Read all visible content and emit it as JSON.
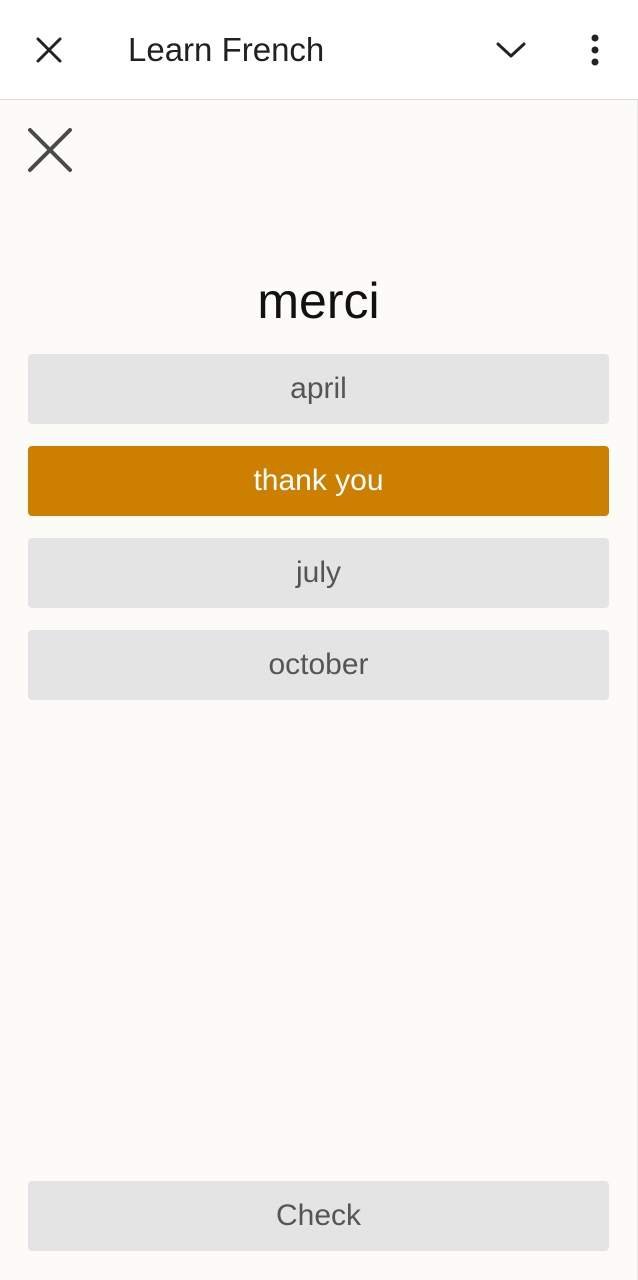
{
  "appbar": {
    "title": "Learn French",
    "close_icon": "close-icon",
    "dropdown_icon": "chevron-down-icon",
    "more_icon": "more-vert-icon"
  },
  "quiz": {
    "close_icon": "close-icon",
    "prompt": "merci",
    "options": [
      {
        "label": "april",
        "selected": false
      },
      {
        "label": "thank you",
        "selected": true
      },
      {
        "label": "july",
        "selected": false
      },
      {
        "label": "october",
        "selected": false
      }
    ],
    "check_label": "Check"
  },
  "colors": {
    "accent": "#cc7f00",
    "option_bg": "#e4e4e4",
    "option_text": "#555555",
    "page_bg": "#fcfbf7",
    "appbar_bg": "#ffffff"
  }
}
